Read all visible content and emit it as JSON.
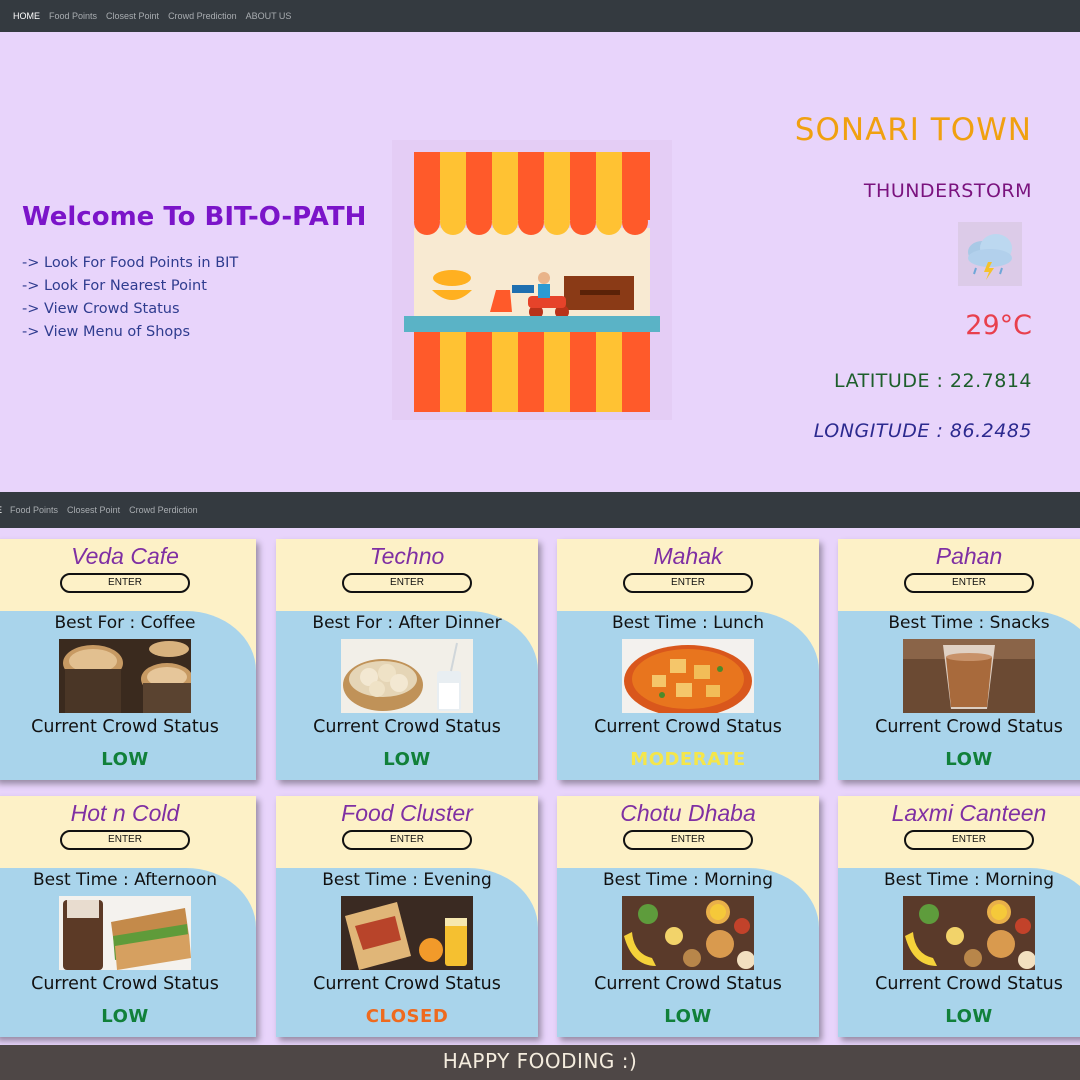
{
  "nav_top": {
    "items": [
      "HOME",
      "Food Points",
      "Closest Point",
      "Crowd Prediction",
      "ABOUT US"
    ]
  },
  "nav_second": {
    "items": [
      "E",
      "Food Points",
      "Closest Point",
      "Crowd Perdiction"
    ]
  },
  "hero": {
    "title": "Welcome To BIT-O-PATH",
    "features": [
      "-> Look For Food Points in BIT",
      "-> Look For Nearest Point",
      "-> View Crowd Status",
      "-> View Menu of Shops"
    ]
  },
  "weather": {
    "town": "SONARI TOWN",
    "condition": "THUNDERSTORM",
    "icon": "thunderstorm-cloud-icon",
    "temperature": "29°C",
    "latitude": "LATITUDE : 22.7814",
    "longitude": "LONGITUDE : 86.2485"
  },
  "colors": {
    "low": "#11803a",
    "moderate": "#f5e64a",
    "closed": "#ee6a1e",
    "card_bg": "#fdf1c7",
    "card_blue": "#a9d4eb"
  },
  "shops": [
    {
      "name": "Veda Cafe",
      "enter": "ENTER",
      "best": "Best For : Coffee",
      "image": "coffee",
      "crowd_label": "Current Crowd Status",
      "status": "LOW",
      "status_color": "#11803a"
    },
    {
      "name": "Techno",
      "enter": "ENTER",
      "best": "Best For : After Dinner",
      "image": "momos",
      "crowd_label": "Current Crowd Status",
      "status": "LOW",
      "status_color": "#11803a"
    },
    {
      "name": "Mahak",
      "enter": "ENTER",
      "best": "Best Time : Lunch",
      "image": "curry",
      "crowd_label": "Current Crowd Status",
      "status": "MODERATE",
      "status_color": "#f5e64a"
    },
    {
      "name": "Pahan",
      "enter": "ENTER",
      "best": "Best Time : Snacks",
      "image": "tea",
      "crowd_label": "Current Crowd Status",
      "status": "LOW",
      "status_color": "#11803a"
    },
    {
      "name": "Hot n Cold",
      "enter": "ENTER",
      "best": "Best Time : Afternoon",
      "image": "sandwich",
      "crowd_label": "Current Crowd Status",
      "status": "LOW",
      "status_color": "#11803a"
    },
    {
      "name": "Food Cluster",
      "enter": "ENTER",
      "best": "Best Time : Evening",
      "image": "rolls",
      "crowd_label": "Current Crowd Status",
      "status": "CLOSED",
      "status_color": "#ee6a1e"
    },
    {
      "name": "Chotu Dhaba",
      "enter": "ENTER",
      "best": "Best Time : Morning",
      "image": "breakfast",
      "crowd_label": "Current Crowd Status",
      "status": "LOW",
      "status_color": "#11803a"
    },
    {
      "name": "Laxmi Canteen",
      "enter": "ENTER",
      "best": "Best Time : Morning",
      "image": "breakfast",
      "crowd_label": "Current Crowd Status",
      "status": "LOW",
      "status_color": "#11803a"
    }
  ],
  "footer": {
    "text": "HAPPY FOODING :)"
  }
}
